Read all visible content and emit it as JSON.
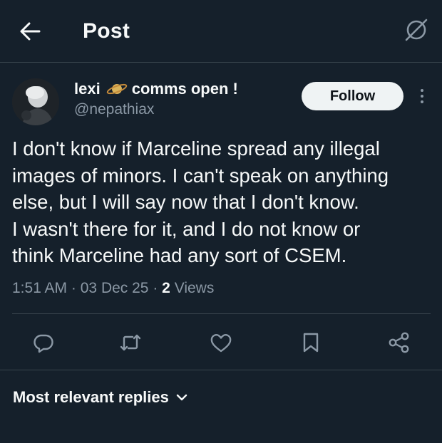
{
  "header": {
    "title": "Post",
    "back_icon": "arrow-left-icon",
    "grok_icon": "grok-icon"
  },
  "author": {
    "name": "lexi",
    "name_emoji": "ringed-planet-icon",
    "name_suffix": "comms open !",
    "handle": "@nepathiax",
    "follow_label": "Follow"
  },
  "tweet": {
    "lines": [
      "I don't know if Marceline spread any illegal",
      "images of minors. I can't speak on anything",
      "else, but I will say now that I don't know.",
      "I wasn't there for it, and I do not know or",
      "think Marceline had any sort of CSEM."
    ],
    "time": "1:51 AM",
    "date": "03 Dec 25",
    "separator": "·",
    "views_count": "2",
    "views_label": "Views"
  },
  "actions": [
    "reply-icon",
    "retweet-icon",
    "like-icon",
    "bookmark-icon",
    "share-icon"
  ],
  "replies": {
    "sort_label": "Most relevant replies"
  },
  "colors": {
    "background": "#15202b",
    "text": "#f7f9f9",
    "secondary": "#8b98a5",
    "divider": "#38444d",
    "follow_bg": "#eff3f4"
  }
}
